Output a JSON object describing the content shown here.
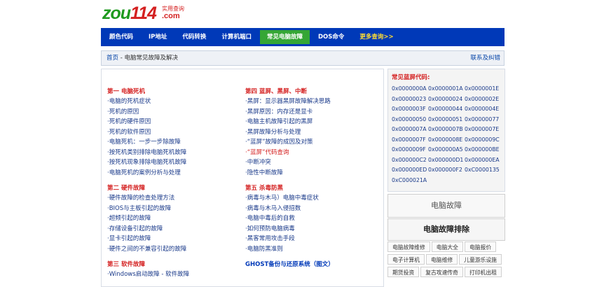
{
  "logo": {
    "prefix": "zou",
    "number": "114",
    "tagline": "实用查询",
    "suffix": ".com"
  },
  "nav": {
    "items": [
      {
        "label": "颜色代码"
      },
      {
        "label": "IP地址"
      },
      {
        "label": "代码转换"
      },
      {
        "label": "计算机端口"
      },
      {
        "label": "常见电脑故障"
      },
      {
        "label": "DOS命令"
      },
      {
        "label": "更多查询>>"
      }
    ],
    "active_index": 4
  },
  "breadcrumb": {
    "home": "首页",
    "separator": " - ",
    "current": "电脑常见故障及解决",
    "feedback": "联系及纠错"
  },
  "left_column": [
    {
      "title": "第一 电脑死机",
      "links": [
        "·电脑的死机症状",
        "·死机的原因",
        "·死机的硬件原因",
        "·死机的软件原因",
        "·电脑死机：一步一步除故障",
        "·按死机类别排除电脑死机故障",
        "·按死机现象排除电脑死机故障",
        "·电脑死机的案例分析与处理"
      ]
    },
    {
      "title": "第二 硬件故障",
      "links": [
        "·硬件故障的检查处理方法",
        "·BIOS与主板引起的故障",
        "·超频引起的故障",
        "·存储设备引起的故障",
        "·显卡引起的故障",
        "·硬件之间的不兼容引起的故障"
      ]
    },
    {
      "title": "第三 软件故障",
      "links": [
        "·Windows启动故障 - 软件故障"
      ]
    }
  ],
  "right_column": [
    {
      "title": "第四 蓝屏、黑屏、中断",
      "links": [
        "·黑屏：显示器黑屏故障解决思路",
        "·黑屏原因：内存还是显卡",
        "·电脑主机故障引起的黑屏",
        "·黑屏故障分析与处理",
        "·“蓝屏”故障的成因及对策",
        "·“蓝屏”代码查询",
        "·中断冲突",
        "·隐性中断故障"
      ],
      "red_links": [
        5
      ]
    },
    {
      "title": "第五 杀毒防黑",
      "links": [
        "·病毒与木马）电脑中毒症状",
        "·病毒与木马入侵招数",
        "·电脑中毒后的自救",
        "·如何预防电脑病毒",
        "·黑客常用攻击手段",
        "·电脑防黑准则"
      ]
    },
    {
      "title": "GHOST备份与还原系统（图文）",
      "links": []
    }
  ],
  "blue_screen": {
    "title": "常见蓝屏代码:",
    "codes": [
      "0x0000000A",
      "0x0000001A",
      "0x0000001E",
      "0x00000023",
      "0x00000024",
      "0x0000002E",
      "0x0000003F",
      "0x00000044",
      "0x0000004E",
      "0x00000050",
      "0x00000051",
      "0x00000077",
      "0x0000007A",
      "0x0000007B",
      "0x0000007E",
      "0x0000007F",
      "0x0000008E",
      "0x0000009C",
      "0x0000009F",
      "0x000000A5",
      "0x000000BE",
      "0x000000C2",
      "0x000000D1",
      "0x000000EA",
      "0x000000ED",
      "0x000000F2",
      "0xC0000135",
      "0xC000021A"
    ]
  },
  "side_boxes": {
    "box1": "电脑故障",
    "box2": "电脑故障排除"
  },
  "side_tags": [
    "电脑故障维修",
    "电脑大全",
    "电脑报价",
    "电子计算机",
    "电脑维修",
    "儿童游乐设施",
    "期货投资",
    "复古攻速传奇",
    "打印机出租"
  ],
  "colors": {
    "nav_bg": "#0039b8",
    "nav_active": "#35a635",
    "heading_red": "#d42020",
    "link_blue": "#1a3a8a",
    "logo_green": "#1f9a1f"
  }
}
